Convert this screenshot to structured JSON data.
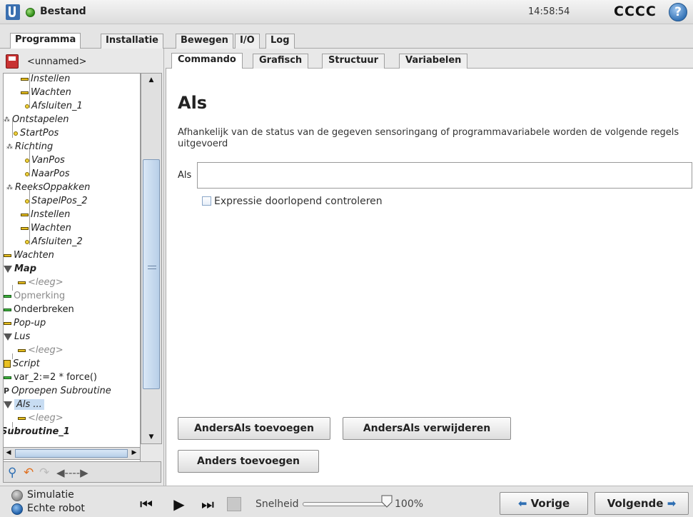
{
  "header": {
    "app_title": "Bestand",
    "clock": "14:58:54",
    "robot_name": "CCCC",
    "help_glyph": "?"
  },
  "main_tabs": [
    {
      "label": "Programma",
      "active": true
    },
    {
      "label": "Installatie",
      "active": false
    },
    {
      "label": "Bewegen",
      "active": false
    },
    {
      "label": "I/O",
      "active": false
    },
    {
      "label": "Log",
      "active": false
    }
  ],
  "program": {
    "filename": "<unnamed>",
    "tree": [
      {
        "label": "Instellen",
        "icon": "bar"
      },
      {
        "label": "Wachten",
        "icon": "bar"
      },
      {
        "label": "Afsluiten_1",
        "icon": "dot"
      },
      {
        "label": "Ontstapelen",
        "icon": "group"
      },
      {
        "label": "StartPos",
        "icon": "dot"
      },
      {
        "label": "Richting",
        "icon": "group"
      },
      {
        "label": "VanPos",
        "icon": "dot"
      },
      {
        "label": "NaarPos",
        "icon": "dot"
      },
      {
        "label": "ReeksOppakken",
        "icon": "group"
      },
      {
        "label": "StapelPos_2",
        "icon": "dot"
      },
      {
        "label": "Instellen",
        "icon": "bar"
      },
      {
        "label": "Wachten",
        "icon": "bar"
      },
      {
        "label": "Afsluiten_2",
        "icon": "dot"
      },
      {
        "label": "Wachten",
        "icon": "bar"
      },
      {
        "label": "Map",
        "icon": "triangle"
      },
      {
        "label": "<leeg>",
        "icon": "bar"
      },
      {
        "label": "Opmerking",
        "icon": "bar-green"
      },
      {
        "label": "Onderbreken",
        "icon": "bar-green"
      },
      {
        "label": "Pop-up",
        "icon": "bar"
      },
      {
        "label": "Lus",
        "icon": "triangle"
      },
      {
        "label": "<leeg>",
        "icon": "bar"
      },
      {
        "label": "Script",
        "icon": "script"
      },
      {
        "label": "var_2:=2 * force()",
        "icon": "bar-green"
      },
      {
        "label": "Oproepen Subroutine",
        "icon": "call"
      },
      {
        "label": "Als ...",
        "icon": "triangle"
      },
      {
        "label": "<leeg>",
        "icon": "bar"
      },
      {
        "label": "Subroutine_1",
        "icon": "none"
      }
    ]
  },
  "sub_tabs": [
    {
      "label": "Commando",
      "active": true
    },
    {
      "label": "Grafisch",
      "active": false
    },
    {
      "label": "Structuur",
      "active": false
    },
    {
      "label": "Variabelen",
      "active": false
    }
  ],
  "command": {
    "title": "Als",
    "description": "Afhankelijk van de status van de gegeven sensoringang of programmavariabele worden de volgende regels uitgevoerd",
    "if_label": "Als",
    "if_value": "",
    "continuous_check_label": "Expressie doorlopend controleren",
    "continuous_check_checked": false,
    "add_elseif_label": "AndersAls toevoegen",
    "remove_elseif_label": "AndersAls verwijderen",
    "add_else_label": "Anders toevoegen"
  },
  "footer": {
    "mode_simulation": "Simulatie",
    "mode_real_robot": "Echte robot",
    "selected_mode": "Echte robot",
    "speed_label": "Snelheid",
    "speed_value": "100%",
    "speed_fraction": 1.0,
    "prev_label": "Vorige",
    "next_label": "Volgende"
  }
}
